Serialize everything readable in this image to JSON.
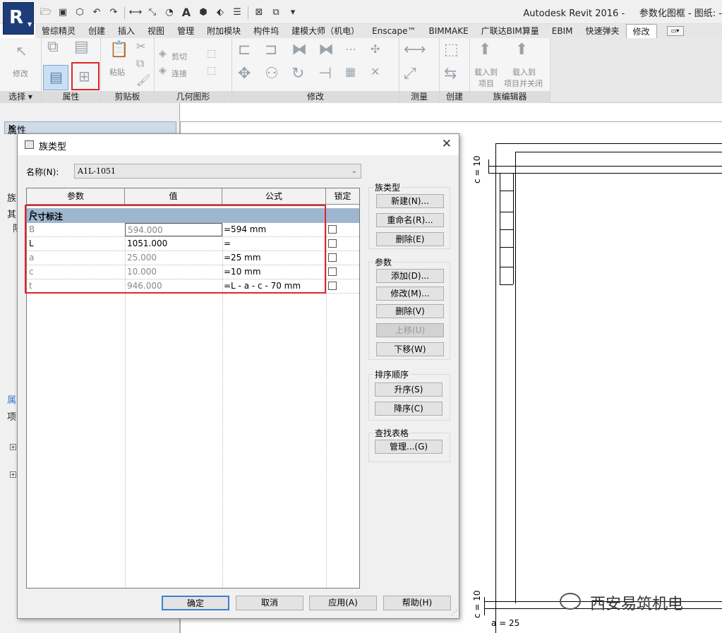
{
  "app": {
    "title": "Autodesk Revit 2016 -",
    "document": "参数化图框 - 图纸: -",
    "quick_access": [
      "open-icon",
      "save-icon",
      "sync-icon",
      "undo-icon",
      "redo-icon",
      "measure-icon",
      "dimension-icon",
      "tag-icon",
      "text-icon",
      "3d-icon",
      "section-icon",
      "thin-lines-icon",
      "close-windows-icon",
      "switch-windows-icon"
    ]
  },
  "tabs": [
    "管综精灵",
    "创建",
    "插入",
    "视图",
    "管理",
    "附加模块",
    "构件坞",
    "建模大师（机电）",
    "Enscape™",
    "BIMMAKE",
    "广联达BIM算量",
    "EBIM",
    "快速弹夹",
    "修改"
  ],
  "ribbon": {
    "panels": [
      {
        "id": "select",
        "title": "选择 ▾",
        "items": [
          "修改"
        ]
      },
      {
        "id": "properties",
        "title": "属性"
      },
      {
        "id": "clipboard",
        "title": "剪贴板",
        "items": [
          "粘贴"
        ]
      },
      {
        "id": "geometry",
        "title": "几何图形",
        "items": [
          "剪切 ▾",
          "连接 ▾"
        ]
      },
      {
        "id": "modify",
        "title": "修改"
      },
      {
        "id": "measure",
        "title": "测量"
      },
      {
        "id": "create",
        "title": "创建"
      },
      {
        "id": "family_editor",
        "title": "族编辑器",
        "items": [
          "载入到\n项目",
          "载入到\n项目并关闭"
        ]
      }
    ],
    "labels": {
      "modify": "修改",
      "paste": "粘贴",
      "cut": "剪切",
      "join": "连接",
      "load_project": "载入到",
      "load_project2": "项目",
      "load_close": "载入到",
      "load_close2": "项目并关闭"
    }
  },
  "left_panel": {
    "title": "属性",
    "fragments": [
      "族",
      "其",
      "限",
      "属",
      "项"
    ]
  },
  "dialog": {
    "title": "族类型",
    "name_label": "名称(N):",
    "name_value": "A1L-1051",
    "columns": [
      "参数",
      "值",
      "公式",
      "锁定"
    ],
    "group": "尺寸标注",
    "rows": [
      {
        "param": "B",
        "value": "594.000",
        "formula": "=594 mm",
        "dark": false
      },
      {
        "param": "L",
        "value": "1051.000",
        "formula": "=",
        "dark": true
      },
      {
        "param": "a",
        "value": "25.000",
        "formula": "=25 mm",
        "dark": false
      },
      {
        "param": "c",
        "value": "10.000",
        "formula": "=10 mm",
        "dark": false
      },
      {
        "param": "t",
        "value": "946.000",
        "formula": "=L - a - c - 70 mm",
        "dark": false
      }
    ],
    "family_types": {
      "title": "族类型",
      "new": "新建(N)...",
      "rename": "重命名(R)...",
      "delete": "删除(E)"
    },
    "parameters": {
      "title": "参数",
      "add": "添加(D)...",
      "modify": "修改(M)...",
      "delete": "删除(V)",
      "move_up": "上移(U)",
      "move_down": "下移(W)"
    },
    "sort": {
      "title": "排序顺序",
      "asc": "升序(S)",
      "desc": "降序(C)"
    },
    "lookup": {
      "title": "查找表格",
      "manage": "管理...(G)"
    },
    "buttons": {
      "ok": "确定",
      "cancel": "取消",
      "apply": "应用(A)",
      "help": "帮助(H)"
    }
  },
  "drawing": {
    "dim_c_top": "c = 10",
    "dim_c_bottom": "c = 10",
    "dim_a": "a = 25"
  },
  "watermark": "西安易筑机电"
}
